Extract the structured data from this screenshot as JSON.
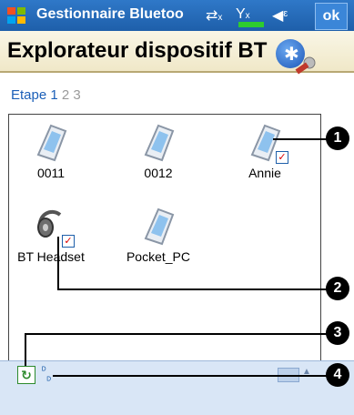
{
  "titlebar": {
    "app_title": "Gestionnaire Bluetoo",
    "ok_label": "ok",
    "icons": [
      "start-flag-icon",
      "connectivity-icon",
      "signal-icon",
      "speaker-icon"
    ]
  },
  "header": {
    "title": "Explorateur dispositif BT"
  },
  "steps": {
    "label": "Etape",
    "current": "1",
    "next": "2",
    "last": "3"
  },
  "devices": [
    {
      "name": "0011",
      "checked": false
    },
    {
      "name": "0012",
      "checked": false
    },
    {
      "name": "Annie",
      "checked": true
    },
    {
      "name": "BT Headset",
      "checked": true
    },
    {
      "name": "Pocket_PC",
      "checked": false
    }
  ],
  "callouts": [
    "1",
    "2",
    "3",
    "4"
  ],
  "colors": {
    "titlebar": "#1e5faa",
    "header_bg": "#f0e8c8",
    "link_blue": "#1b5fb8",
    "bottombar": "#d9e6f6"
  }
}
